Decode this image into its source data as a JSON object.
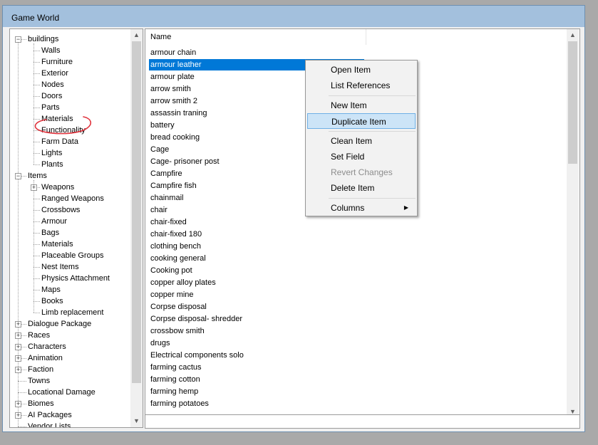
{
  "window": {
    "title": "Game World"
  },
  "tree": {
    "items": [
      {
        "label": "buildings",
        "level": 0,
        "expander": "−"
      },
      {
        "label": "Walls",
        "level": 1
      },
      {
        "label": "Furniture",
        "level": 1
      },
      {
        "label": "Exterior",
        "level": 1
      },
      {
        "label": "Nodes",
        "level": 1
      },
      {
        "label": "Doors",
        "level": 1
      },
      {
        "label": "Parts",
        "level": 1
      },
      {
        "label": "Materials",
        "level": 1
      },
      {
        "label": "Functionality",
        "level": 1
      },
      {
        "label": "Farm Data",
        "level": 1
      },
      {
        "label": "Lights",
        "level": 1
      },
      {
        "label": "Plants",
        "level": 1
      },
      {
        "label": "Items",
        "level": 0,
        "expander": "−"
      },
      {
        "label": "Weapons",
        "level": 1,
        "expander": "+"
      },
      {
        "label": "Ranged Weapons",
        "level": 1
      },
      {
        "label": "Crossbows",
        "level": 1
      },
      {
        "label": "Armour",
        "level": 1
      },
      {
        "label": "Bags",
        "level": 1
      },
      {
        "label": "Materials",
        "level": 1
      },
      {
        "label": "Placeable Groups",
        "level": 1
      },
      {
        "label": "Nest Items",
        "level": 1
      },
      {
        "label": "Physics Attachment",
        "level": 1
      },
      {
        "label": "Maps",
        "level": 1
      },
      {
        "label": "Books",
        "level": 1
      },
      {
        "label": "Limb replacement",
        "level": 1
      },
      {
        "label": "Dialogue Package",
        "level": 0,
        "expander": "+"
      },
      {
        "label": "Races",
        "level": 0,
        "expander": "+"
      },
      {
        "label": "Characters",
        "level": 0,
        "expander": "+"
      },
      {
        "label": "Animation",
        "level": 0,
        "expander": "+"
      },
      {
        "label": "Faction",
        "level": 0,
        "expander": "+"
      },
      {
        "label": "Towns",
        "level": 0
      },
      {
        "label": "Locational Damage",
        "level": 0
      },
      {
        "label": "Biomes",
        "level": 0,
        "expander": "+"
      },
      {
        "label": "AI Packages",
        "level": 0,
        "expander": "+"
      },
      {
        "label": "Vendor Lists",
        "level": 0
      }
    ]
  },
  "list": {
    "column_name": "Name",
    "selected_index": 1,
    "rows": [
      "armour chain",
      "armour leather",
      "armour plate",
      "arrow smith",
      "arrow smith 2",
      "assassin traning",
      "battery",
      "bread cooking",
      "Cage",
      "Cage- prisoner post",
      "Campfire",
      "Campfire fish",
      "chainmail",
      "chair",
      "chair-fixed",
      "chair-fixed 180",
      "clothing bench",
      "cooking general",
      "Cooking pot",
      "copper alloy plates",
      "copper mine",
      "Corpse disposal",
      "Corpse disposal- shredder",
      "crossbow smith",
      "drugs",
      "Electrical components solo",
      "farming cactus",
      "farming cotton",
      "farming hemp",
      "farming potatoes"
    ]
  },
  "context_menu": {
    "items": [
      {
        "label": "Open Item",
        "state": "normal"
      },
      {
        "label": "List References",
        "state": "normal"
      },
      {
        "label": "New Item",
        "state": "normal"
      },
      {
        "label": "Duplicate Item",
        "state": "hover"
      },
      {
        "label": "Clean Item",
        "state": "normal"
      },
      {
        "label": "Set Field",
        "state": "normal"
      },
      {
        "label": "Revert Changes",
        "state": "disabled"
      },
      {
        "label": "Delete Item",
        "state": "normal"
      },
      {
        "label": "Columns",
        "state": "normal",
        "submenu": true
      }
    ]
  },
  "colors": {
    "selection": "#0078d7",
    "menu_hover": "#cce4f7",
    "annotation": "#e0323c"
  }
}
